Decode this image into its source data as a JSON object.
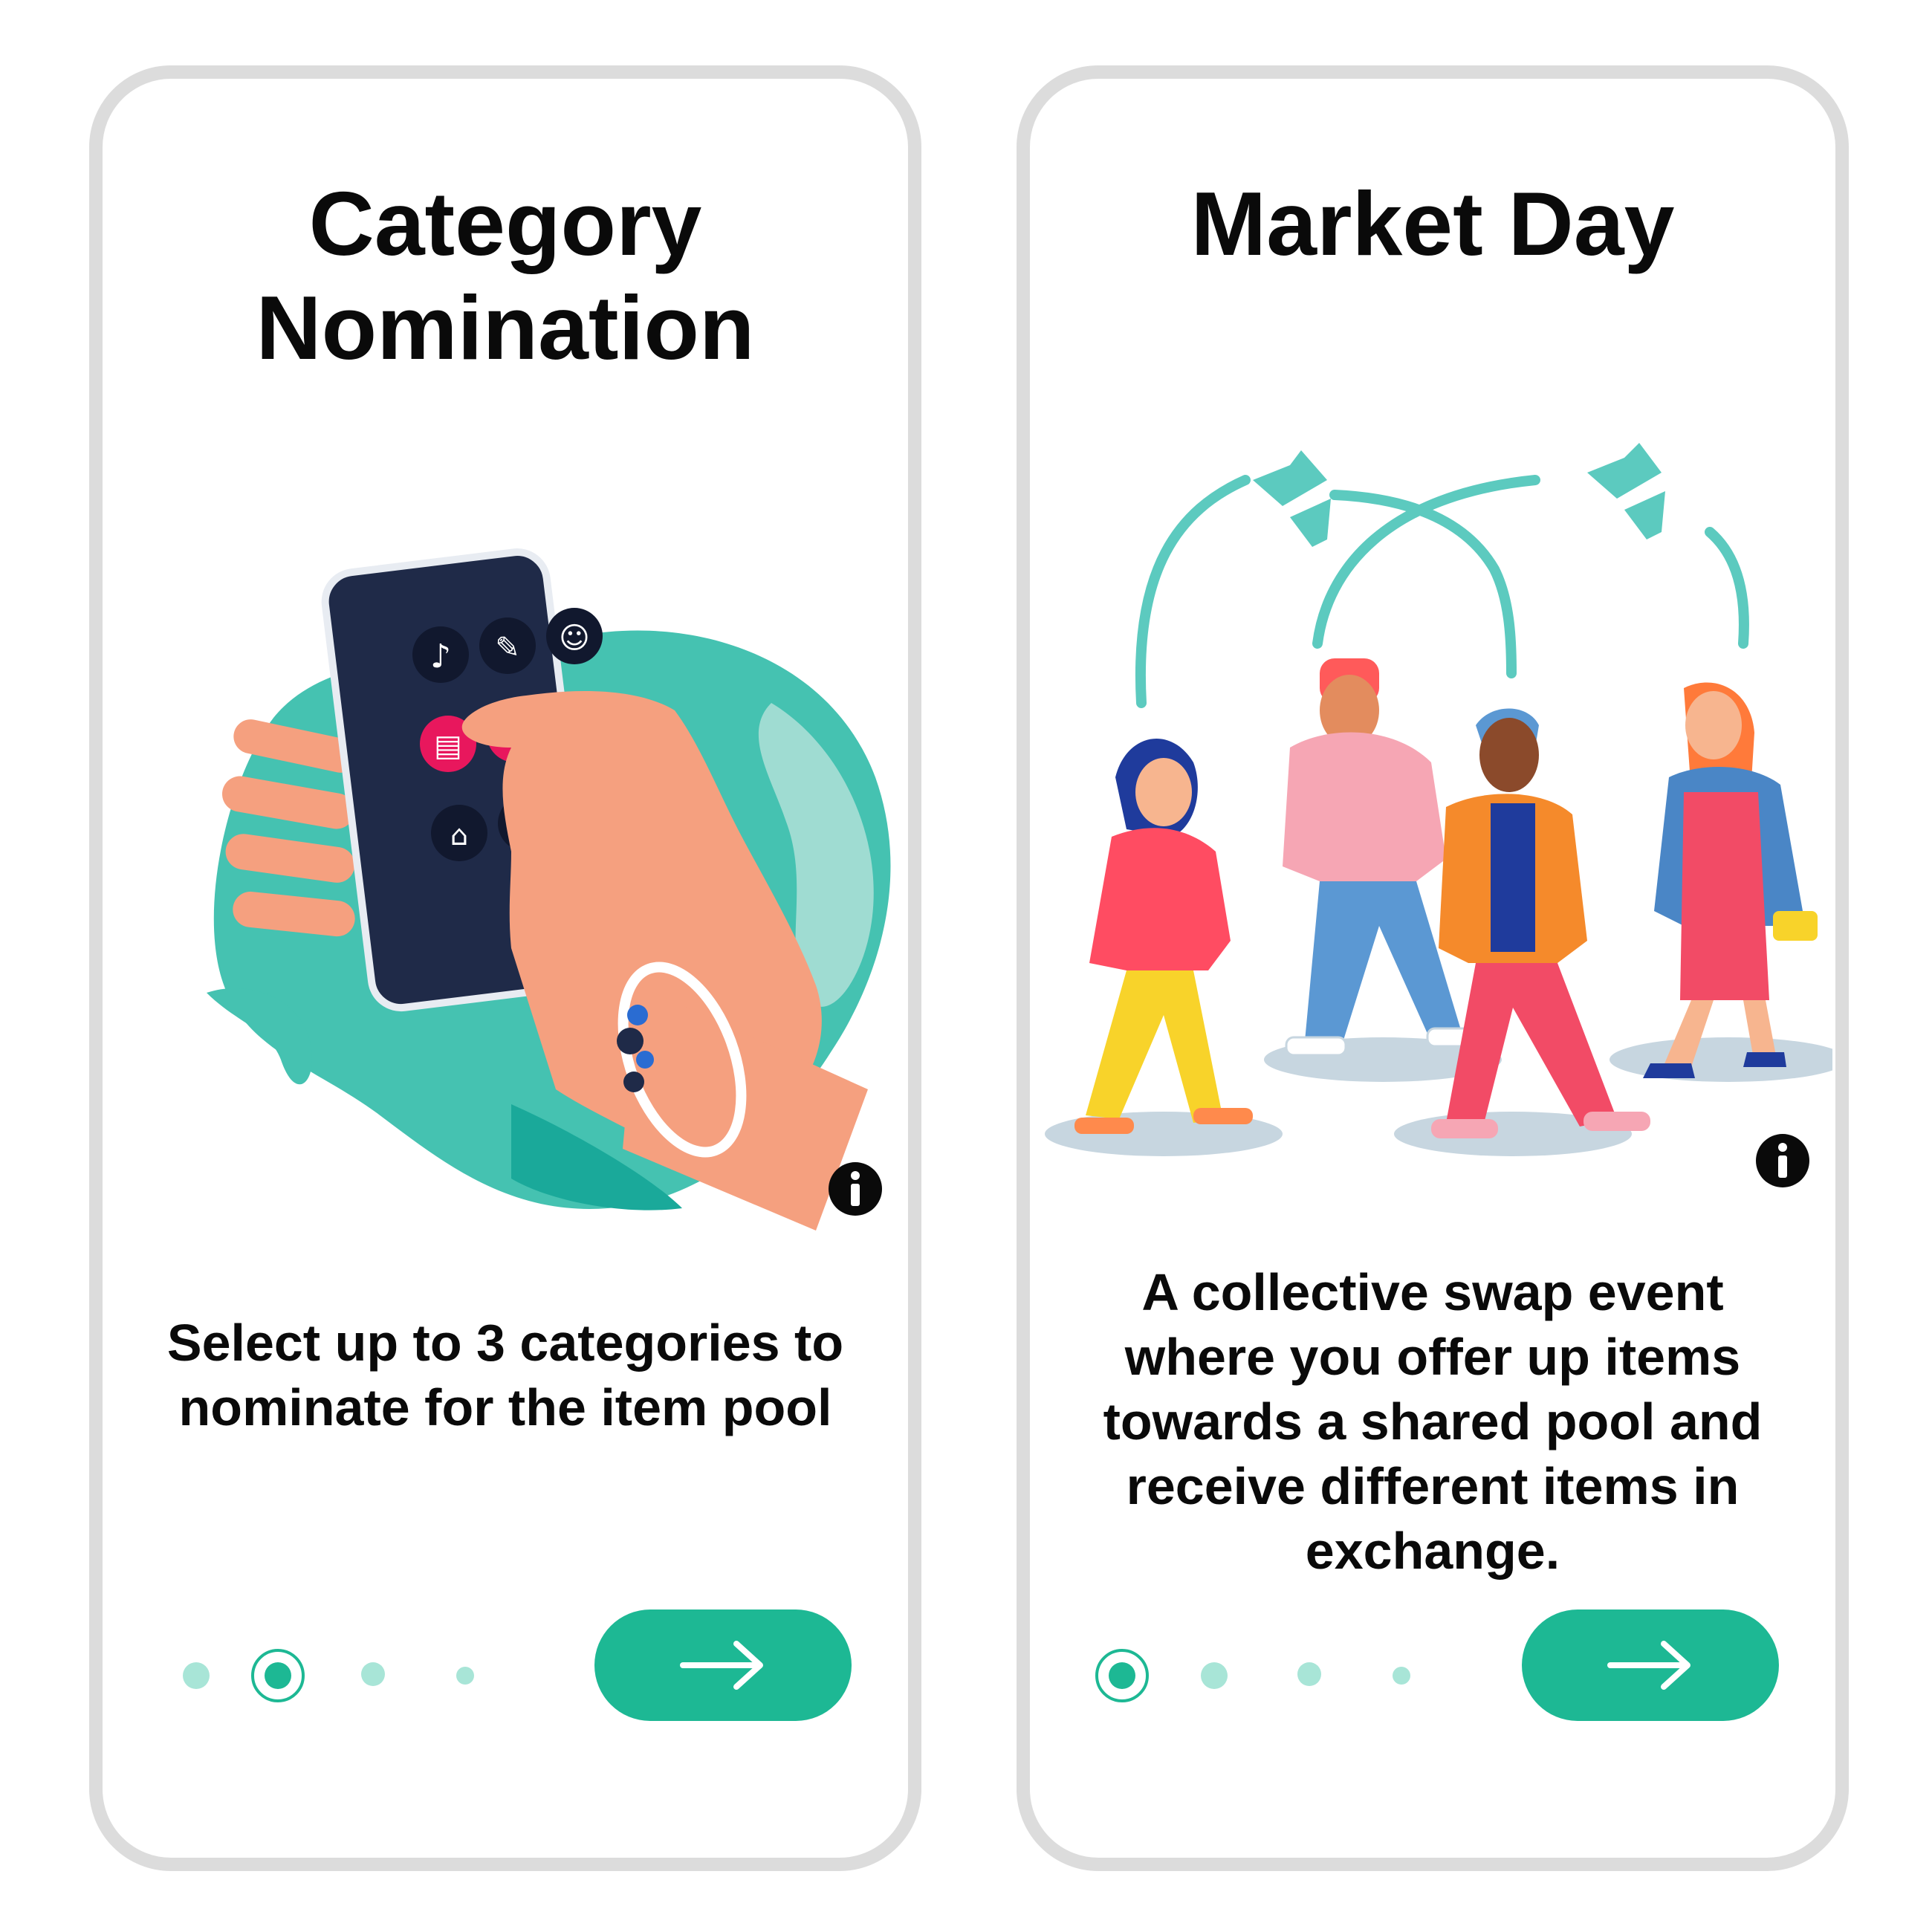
{
  "screens": [
    {
      "title": "Category\nNomination",
      "description": "Select up to 3 categories to nominate for the item pool",
      "pagination": {
        "total": 4,
        "active_index": 1
      },
      "next_button_icon": "arrow-right-icon",
      "info_icon": "info-icon"
    },
    {
      "title": "Market Day",
      "description": "A collective swap event where you offer up items towards a shared pool and receive different items in exchange.",
      "pagination": {
        "total": 4,
        "active_index": 0
      },
      "next_button_icon": "arrow-right-icon",
      "info_icon": "info-icon"
    }
  ],
  "colors": {
    "accent": "#1db894",
    "dot_inactive": "#a8e5d7",
    "card_border": "#dcdcdc",
    "phone_body": "#1f2a48",
    "category_highlight": "#e8175d",
    "skin": "#f5a07f",
    "blob_teal": "#45c2b1"
  }
}
